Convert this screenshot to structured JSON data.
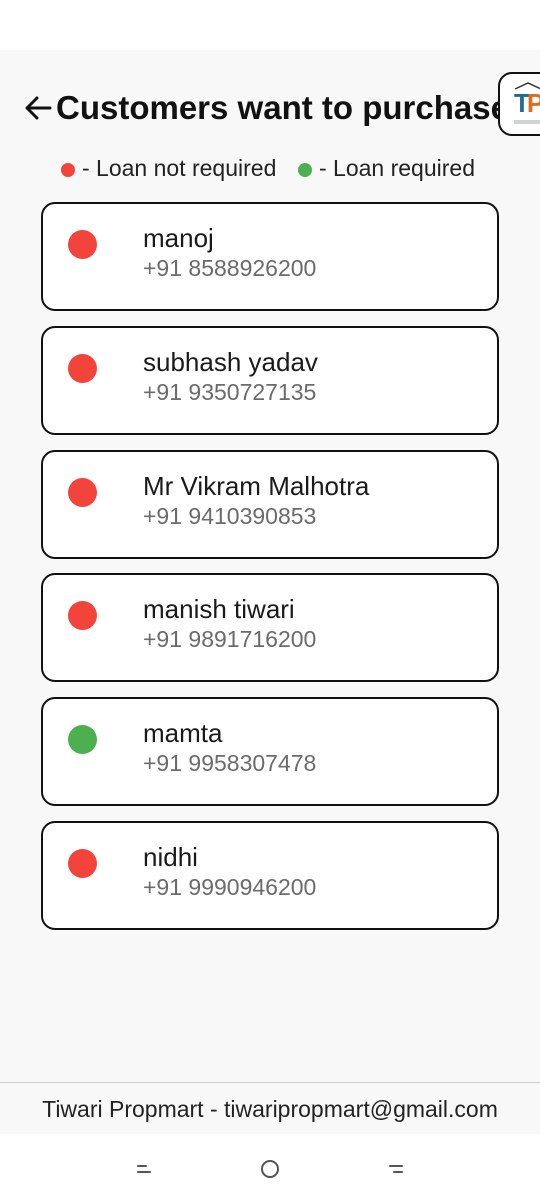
{
  "header": {
    "title": "Customers want to purchase"
  },
  "logo": {
    "letters_t": "T",
    "letters_p": "P"
  },
  "legend": {
    "not_required": "- Loan not required",
    "required": "- Loan required"
  },
  "colors": {
    "red": "#f2443a",
    "green": "#4caf50"
  },
  "customers": [
    {
      "name": "manoj",
      "phone": "+91 8588926200",
      "status": "red"
    },
    {
      "name": "subhash yadav",
      "phone": "+91 9350727135",
      "status": "red"
    },
    {
      "name": "Mr Vikram Malhotra",
      "phone": "+91 9410390853",
      "status": "red"
    },
    {
      "name": "manish tiwari",
      "phone": "+91 9891716200",
      "status": "red"
    },
    {
      "name": "mamta",
      "phone": "+91 9958307478",
      "status": "green"
    },
    {
      "name": "nidhi",
      "phone": "+91 9990946200",
      "status": "red"
    }
  ],
  "footer": {
    "text": "Tiwari Propmart - tiwaripropmart@gmail.com"
  },
  "nav": {
    "icons": [
      "recents-icon",
      "home-icon",
      "back-icon"
    ]
  }
}
